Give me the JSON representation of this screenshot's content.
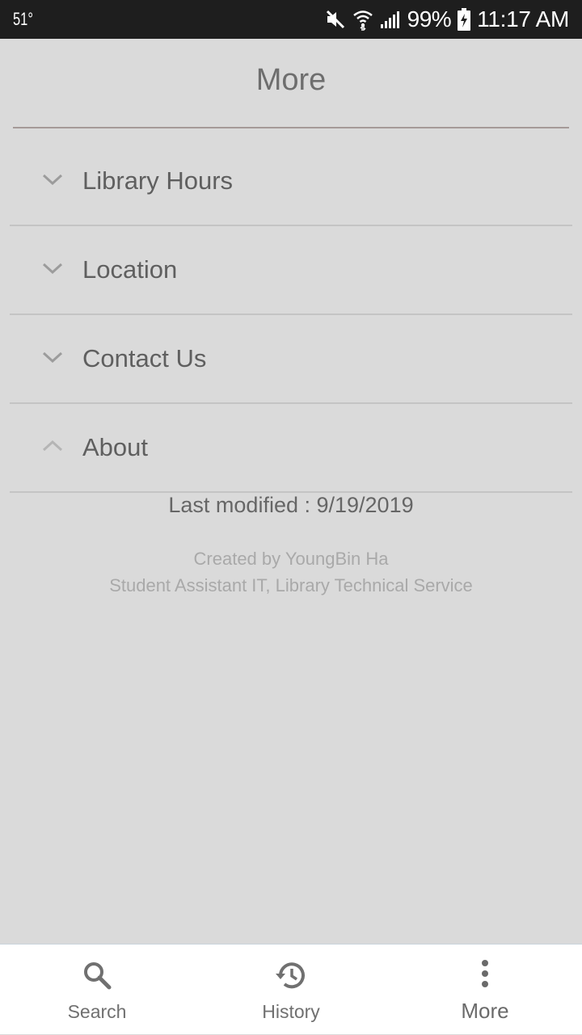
{
  "status_bar": {
    "temperature": "51°",
    "battery_percent": "99%",
    "time": "11:17 AM",
    "icons": [
      "mute-icon",
      "wifi-icon",
      "signal-icon",
      "battery-charging-icon"
    ]
  },
  "header": {
    "title": "More"
  },
  "accordion": {
    "items": [
      {
        "label": "Library Hours",
        "expanded": false,
        "icon": "chevron-down-icon"
      },
      {
        "label": "Location",
        "expanded": false,
        "icon": "chevron-down-icon"
      },
      {
        "label": "Contact Us",
        "expanded": false,
        "icon": "chevron-down-icon"
      },
      {
        "label": "About",
        "expanded": true,
        "icon": "chevron-up-icon"
      }
    ]
  },
  "about": {
    "last_modified": "Last modified : 9/19/2019",
    "created_by": "Created by YoungBin Ha",
    "role": "Student Assistant IT, Library Technical Service"
  },
  "bottom_nav": {
    "items": [
      {
        "label": "Search",
        "icon": "search-icon",
        "active": false
      },
      {
        "label": "History",
        "icon": "history-icon",
        "active": false
      },
      {
        "label": "More",
        "icon": "more-vertical-icon",
        "active": true
      }
    ]
  },
  "colors": {
    "background": "#dadada",
    "status_bar": "#1e1e1e",
    "divider_accent": "#a59a98",
    "text_primary": "#5f5f5f",
    "text_muted": "#a9a9a9",
    "nav_background": "#ffffff"
  }
}
